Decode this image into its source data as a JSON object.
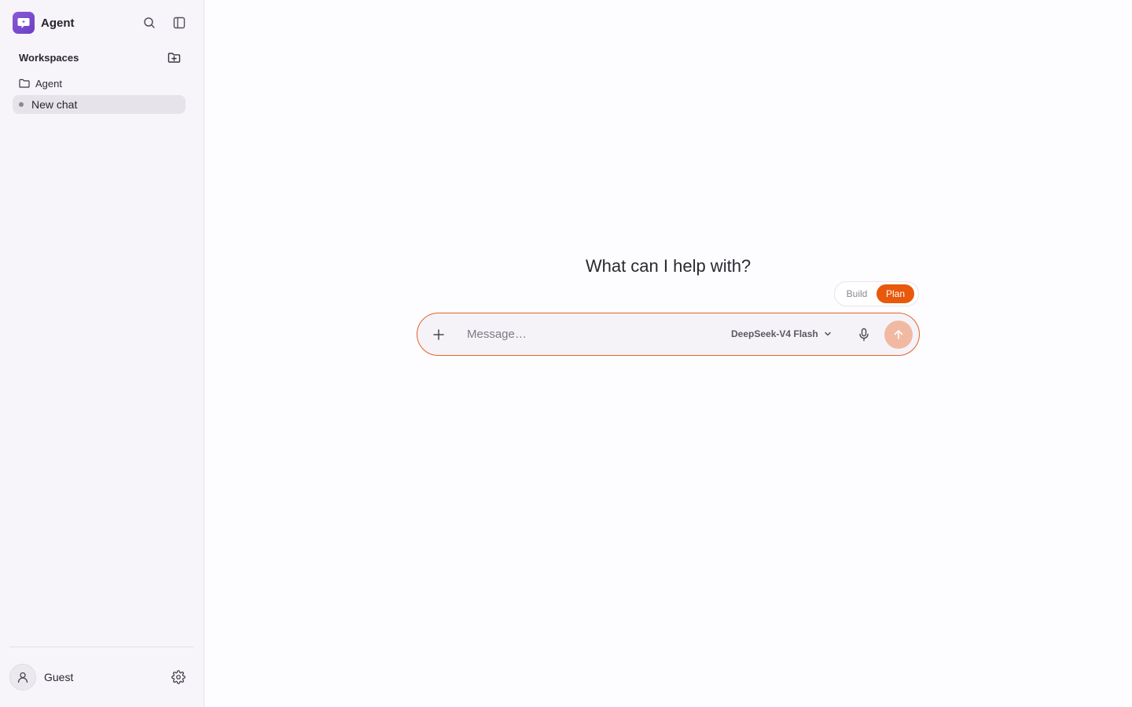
{
  "app": {
    "title": "Agent",
    "accent": "#e8590c",
    "brand": "#7b4ccf"
  },
  "sidebar": {
    "section_label": "Workspaces",
    "folders": [
      {
        "label": "Agent"
      }
    ],
    "chats": [
      {
        "label": "New chat",
        "active": true
      }
    ],
    "user": {
      "name": "Guest"
    }
  },
  "main": {
    "heading": "What can I help with?",
    "modes": [
      {
        "label": "Build",
        "active": false
      },
      {
        "label": "Plan",
        "active": true
      }
    ],
    "composer": {
      "placeholder": "Message…",
      "value": "",
      "model": "DeepSeek-V4 Flash"
    }
  },
  "icons": {
    "logo": "chat-bubble-sparkle-icon",
    "search": "search-icon",
    "sidebar_toggle": "sidebar-panel-icon",
    "new_folder": "folder-plus-icon",
    "folder": "folder-icon",
    "user": "user-icon",
    "settings": "gear-icon",
    "attach": "plus-icon",
    "model_chevron": "chevron-down-icon",
    "mic": "microphone-icon",
    "send": "arrow-up-icon"
  }
}
